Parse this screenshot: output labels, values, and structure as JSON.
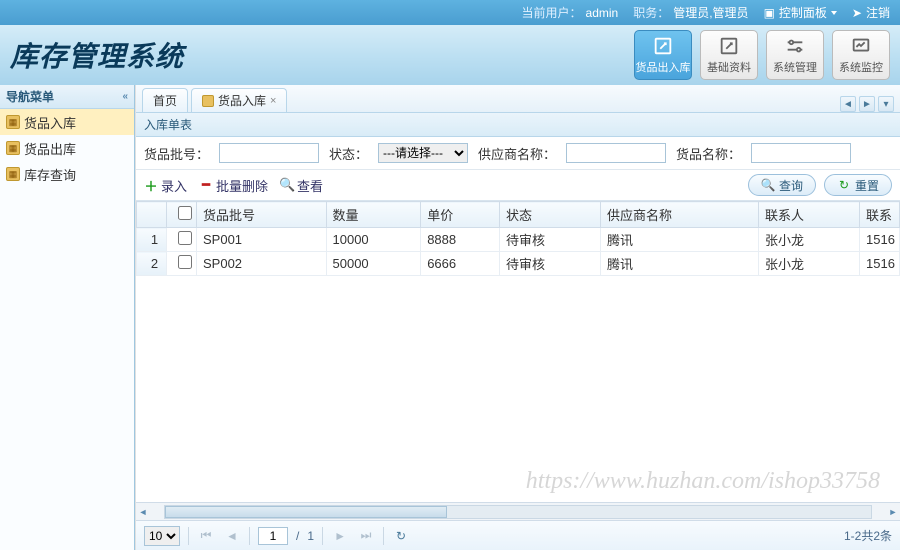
{
  "topbar": {
    "user_label": "当前用户：",
    "user": "admin",
    "role_label": "职务：",
    "role": "管理员,管理员",
    "control_panel": "控制面板",
    "logout": "注销"
  },
  "app_title": "库存管理系统",
  "header_btns": [
    {
      "label": "货品出入库",
      "active": true
    },
    {
      "label": "基础资料",
      "active": false
    },
    {
      "label": "系统管理",
      "active": false
    },
    {
      "label": "系统监控",
      "active": false
    }
  ],
  "sidebar": {
    "title": "导航菜单",
    "items": [
      {
        "label": "货品入库",
        "active": true
      },
      {
        "label": "货品出库",
        "active": false
      },
      {
        "label": "库存查询",
        "active": false
      }
    ]
  },
  "tabs": [
    {
      "label": "首页",
      "closable": false,
      "icon": false
    },
    {
      "label": "货品入库",
      "closable": true,
      "icon": true
    }
  ],
  "panel_title": "入库单表",
  "search": {
    "batch_label": "货品批号：",
    "batch_value": "",
    "status_label": "状态：",
    "status_placeholder": "---请选择---",
    "supplier_label": "供应商名称：",
    "supplier_value": "",
    "name_label": "货品名称：",
    "name_value": ""
  },
  "toolbar": {
    "add": "录入",
    "del": "批量删除",
    "view": "查看",
    "query": "查询",
    "reset": "重置"
  },
  "columns": [
    "货品批号",
    "数量",
    "单价",
    "状态",
    "供应商名称",
    "联系人",
    "联系"
  ],
  "rows": [
    {
      "n": 1,
      "batch": "SP001",
      "qty": "10000",
      "price": "8888",
      "status": "待审核",
      "supplier": "腾讯",
      "contact": "张小龙",
      "phone": "1516"
    },
    {
      "n": 2,
      "batch": "SP002",
      "qty": "50000",
      "price": "6666",
      "status": "待审核",
      "supplier": "腾讯",
      "contact": "张小龙",
      "phone": "1516"
    }
  ],
  "pager": {
    "pagesize": "10",
    "current": "1",
    "total_pages": "1",
    "summary": "1-2共2条"
  },
  "watermark": "https://www.huzhan.com/ishop33758"
}
